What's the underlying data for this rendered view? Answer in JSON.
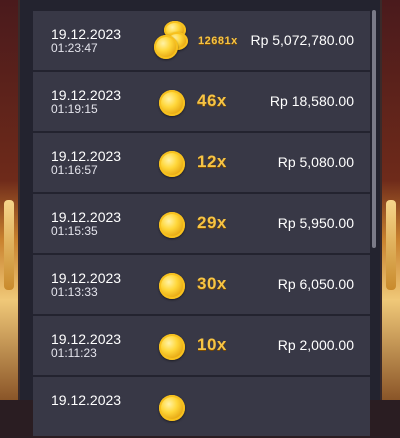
{
  "history": {
    "rows": [
      {
        "date": "19.12.2023",
        "time": "01:23:47",
        "multiplier": "12681x",
        "amount": "Rp 5,072,780.00",
        "icon": "coin-pile-icon"
      },
      {
        "date": "19.12.2023",
        "time": "01:19:15",
        "multiplier": "46x",
        "amount": "Rp 18,580.00",
        "icon": "coin-icon"
      },
      {
        "date": "19.12.2023",
        "time": "01:16:57",
        "multiplier": "12x",
        "amount": "Rp 5,080.00",
        "icon": "coin-icon"
      },
      {
        "date": "19.12.2023",
        "time": "01:15:35",
        "multiplier": "29x",
        "amount": "Rp 5,950.00",
        "icon": "coin-icon"
      },
      {
        "date": "19.12.2023",
        "time": "01:13:33",
        "multiplier": "30x",
        "amount": "Rp 6,050.00",
        "icon": "coin-icon"
      },
      {
        "date": "19.12.2023",
        "time": "01:11:23",
        "multiplier": "10x",
        "amount": "Rp 2,000.00",
        "icon": "coin-icon"
      },
      {
        "date": "19.12.2023",
        "time": "",
        "multiplier": "",
        "amount": "",
        "icon": "coin-icon"
      }
    ]
  },
  "colors": {
    "row_bg": "#383846",
    "panel_bg": "#23232f",
    "multiplier": "#f6c445"
  }
}
